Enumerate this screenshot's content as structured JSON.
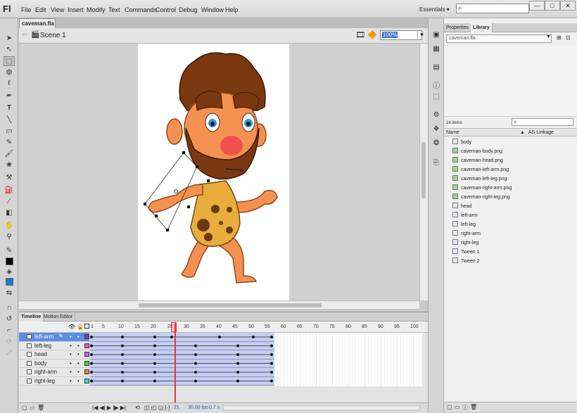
{
  "app": {
    "logo": "Fl",
    "essentials": "Essentials ▾",
    "search_icon": "⌕"
  },
  "menu": [
    "File",
    "Edit",
    "View",
    "Insert",
    "Modify",
    "Text",
    "Commands",
    "Control",
    "Debug",
    "Window",
    "Help"
  ],
  "window_buttons": [
    "—",
    "□",
    "✕"
  ],
  "document": {
    "tab": "caveman.fla",
    "tab_close": "×",
    "scene": "Scene 1",
    "zoom": "100%"
  },
  "toolbox_icons": [
    "selection-tool",
    "subselection-tool",
    "free-transform-tool",
    "3d-rotation-tool",
    "lasso-tool",
    "pen-tool",
    "text-tool",
    "line-tool",
    "rectangle-tool",
    "pencil-tool",
    "brush-tool",
    "deco-tool",
    "bone-tool",
    "paint-bucket-tool",
    "eyedropper-tool",
    "eraser-tool",
    "hand-tool",
    "zoom-tool",
    "stroke-color",
    "fill-color",
    "swap-colors"
  ],
  "colors": {
    "stroke": "#000000",
    "fill": "#1b73d9",
    "frames": "#c5cdf0",
    "playhead": "#e03a3a"
  },
  "timeline": {
    "tabs": [
      "Timeline",
      "Motion Editor"
    ],
    "frame_numbers": [
      "1",
      "5",
      "10",
      "15",
      "20",
      "25",
      "30",
      "35",
      "40",
      "45",
      "50",
      "55",
      "60",
      "65",
      "70",
      "75",
      "80",
      "85",
      "90",
      "95",
      "100"
    ],
    "layers": [
      {
        "name": "left-arm",
        "color": "#8a3ac0",
        "selected": true
      },
      {
        "name": "left-leg",
        "color": "#e05ad8",
        "selected": false
      },
      {
        "name": "head",
        "color": "#e05ad8",
        "selected": false
      },
      {
        "name": "body",
        "color": "#3ad83a",
        "selected": false
      },
      {
        "name": "right-arm",
        "color": "#e0863a",
        "selected": false
      },
      {
        "name": "right-leg",
        "color": "#3ad8d8",
        "selected": false
      }
    ],
    "current_frame": "21",
    "fps": "30.00 fps",
    "time": "0.7 s"
  },
  "library": {
    "tabs": [
      "Properties",
      "Library"
    ],
    "document": "caveman.fla",
    "count": "14 items",
    "col_name": "Name",
    "col_linkage": "AS Linkage",
    "items": [
      {
        "name": "body",
        "kind": "symbol"
      },
      {
        "name": "caveman-body.png",
        "kind": "bitmap"
      },
      {
        "name": "caveman-head.png",
        "kind": "bitmap"
      },
      {
        "name": "caveman-left-arm.png",
        "kind": "bitmap"
      },
      {
        "name": "caveman-left-leg.png",
        "kind": "bitmap"
      },
      {
        "name": "caveman-right-arm.png",
        "kind": "bitmap"
      },
      {
        "name": "caveman-right-leg.png",
        "kind": "bitmap"
      },
      {
        "name": "head",
        "kind": "symbol"
      },
      {
        "name": "left-arm",
        "kind": "symbol"
      },
      {
        "name": "left-leg",
        "kind": "symbol"
      },
      {
        "name": "right-arm",
        "kind": "symbol"
      },
      {
        "name": "right-leg",
        "kind": "symbol"
      },
      {
        "name": "Tween 1",
        "kind": "symbol"
      },
      {
        "name": "Tween 2",
        "kind": "symbol"
      }
    ]
  }
}
